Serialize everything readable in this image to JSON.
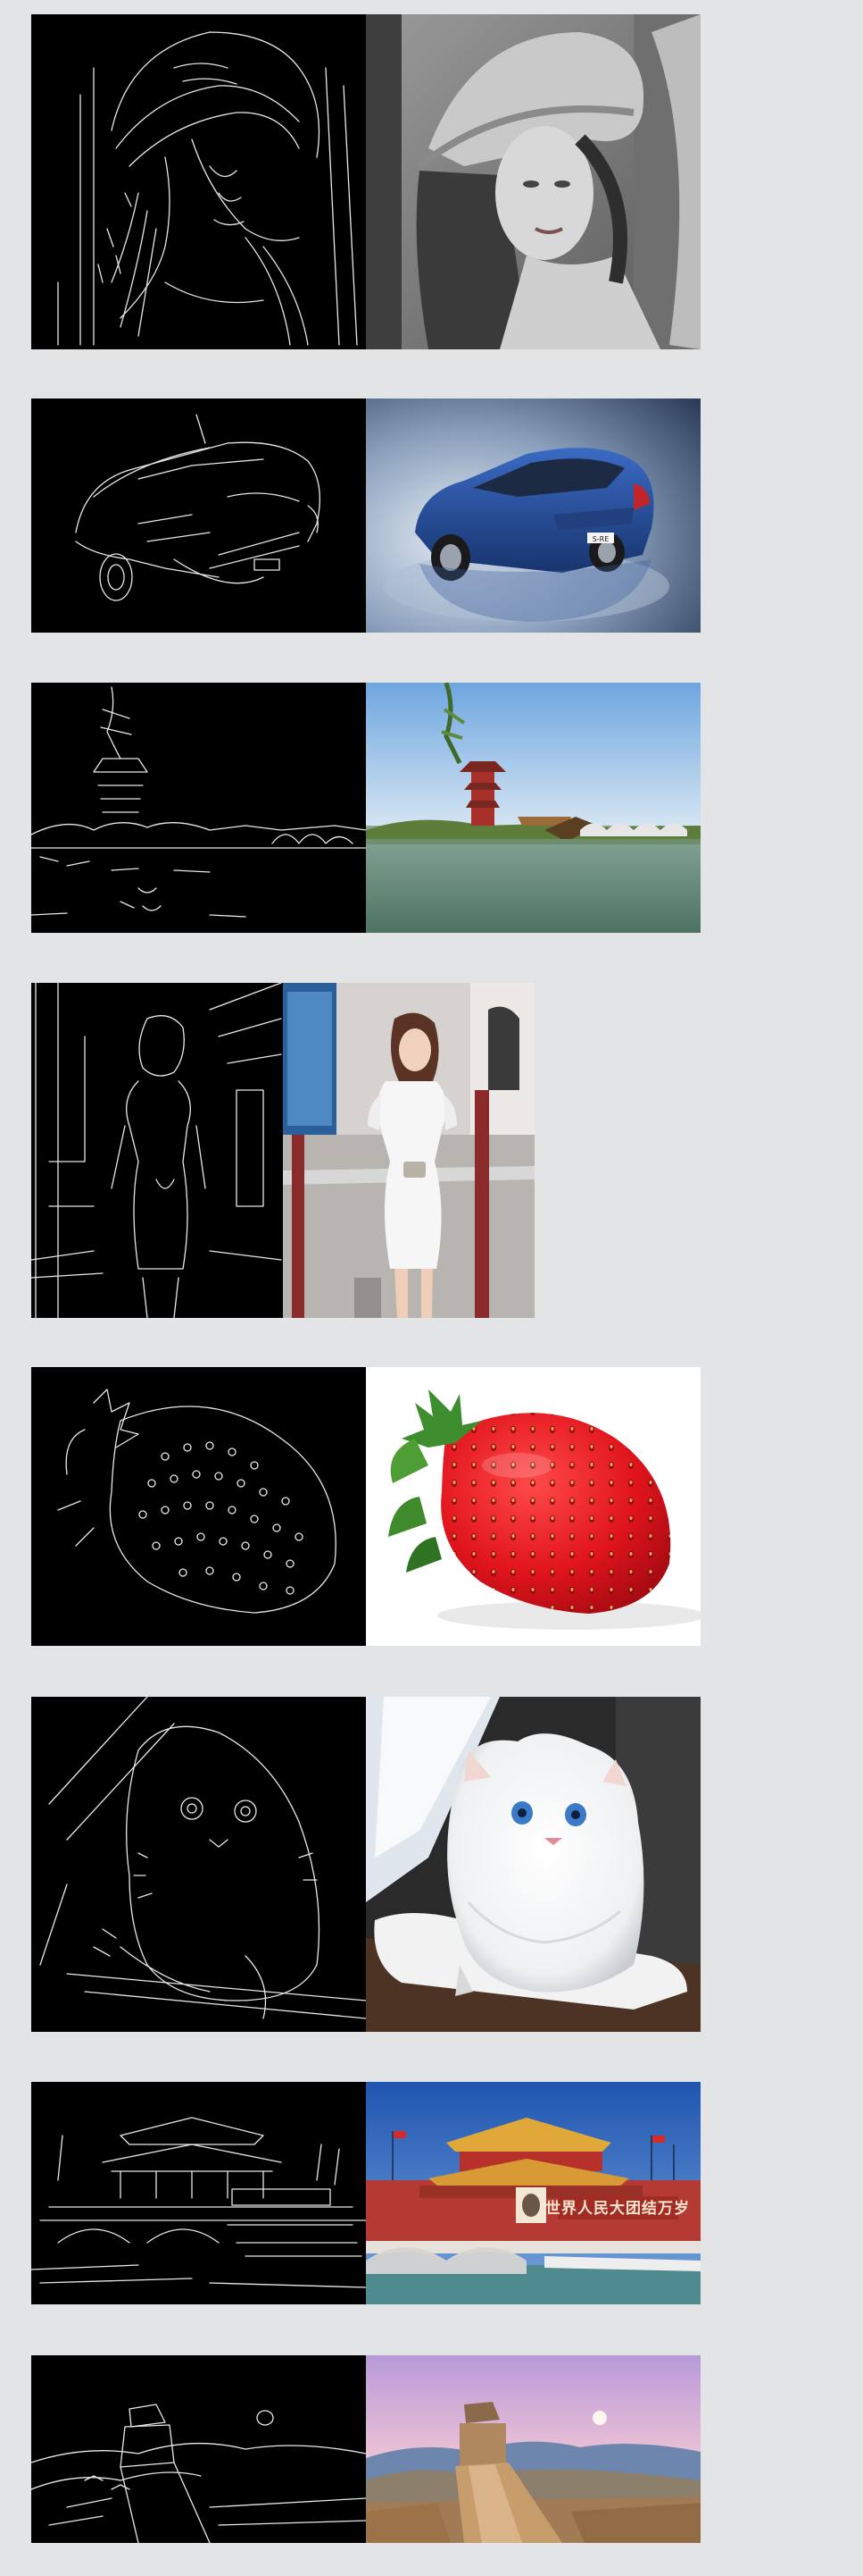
{
  "gallery": {
    "pairs": [
      {
        "subject": "portrait",
        "edge_label": "",
        "photo_label": ""
      },
      {
        "subject": "car",
        "badge_text": "S-RE"
      },
      {
        "subject": "pavilion"
      },
      {
        "subject": "woman"
      },
      {
        "subject": "strawberry"
      },
      {
        "subject": "cat"
      },
      {
        "subject": "tiananmen",
        "banner_text": "世界人民大团结万岁"
      },
      {
        "subject": "great-wall"
      }
    ]
  },
  "colors": {
    "page_background": "#e3e4e6",
    "edge_background": "#000000",
    "edge_stroke": "#e8e8e8"
  }
}
